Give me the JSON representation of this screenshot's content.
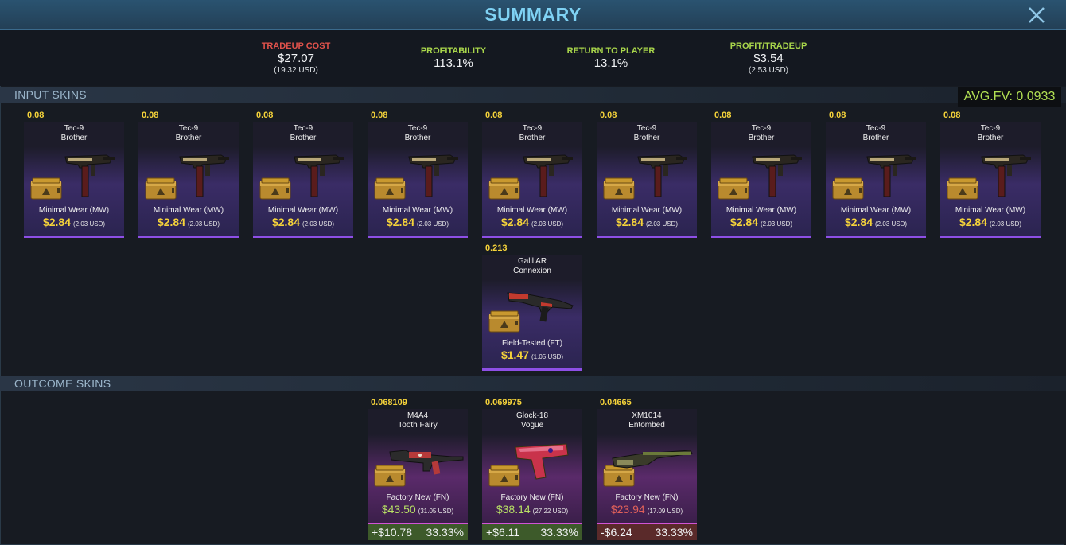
{
  "header": {
    "title": "SUMMARY"
  },
  "stats": {
    "cost": {
      "label": "TRADEUP COST",
      "value": "$27.07",
      "sub": "(19.32 USD)"
    },
    "profitability": {
      "label": "PROFITABILITY",
      "value": "113.1%"
    },
    "rtp": {
      "label": "RETURN TO PLAYER",
      "value": "13.1%"
    },
    "profit": {
      "label": "PROFIT/TRADEUP",
      "value": "$3.54",
      "sub": "(2.53 USD)"
    }
  },
  "input_section": {
    "title": "INPUT SKINS",
    "avg_fv": "AVG.FV: 0.0933"
  },
  "outcome_section": {
    "title": "OUTCOME SKINS"
  },
  "inputs": [
    {
      "fv": "0.08",
      "weapon": "Tec-9",
      "skin": "Brother",
      "wear": "Minimal Wear (MW)",
      "price": "$2.84",
      "usd": "(2.03 USD)"
    },
    {
      "fv": "0.08",
      "weapon": "Tec-9",
      "skin": "Brother",
      "wear": "Minimal Wear (MW)",
      "price": "$2.84",
      "usd": "(2.03 USD)"
    },
    {
      "fv": "0.08",
      "weapon": "Tec-9",
      "skin": "Brother",
      "wear": "Minimal Wear (MW)",
      "price": "$2.84",
      "usd": "(2.03 USD)"
    },
    {
      "fv": "0.08",
      "weapon": "Tec-9",
      "skin": "Brother",
      "wear": "Minimal Wear (MW)",
      "price": "$2.84",
      "usd": "(2.03 USD)"
    },
    {
      "fv": "0.08",
      "weapon": "Tec-9",
      "skin": "Brother",
      "wear": "Minimal Wear (MW)",
      "price": "$2.84",
      "usd": "(2.03 USD)"
    },
    {
      "fv": "0.08",
      "weapon": "Tec-9",
      "skin": "Brother",
      "wear": "Minimal Wear (MW)",
      "price": "$2.84",
      "usd": "(2.03 USD)"
    },
    {
      "fv": "0.08",
      "weapon": "Tec-9",
      "skin": "Brother",
      "wear": "Minimal Wear (MW)",
      "price": "$2.84",
      "usd": "(2.03 USD)"
    },
    {
      "fv": "0.08",
      "weapon": "Tec-9",
      "skin": "Brother",
      "wear": "Minimal Wear (MW)",
      "price": "$2.84",
      "usd": "(2.03 USD)"
    },
    {
      "fv": "0.08",
      "weapon": "Tec-9",
      "skin": "Brother",
      "wear": "Minimal Wear (MW)",
      "price": "$2.84",
      "usd": "(2.03 USD)"
    },
    {
      "fv": "0.213",
      "weapon": "Galil AR",
      "skin": "Connexion",
      "wear": "Field-Tested (FT)",
      "price": "$1.47",
      "usd": "(1.05 USD)"
    }
  ],
  "outcomes": [
    {
      "fv": "0.068109",
      "weapon": "M4A4",
      "skin": "Tooth Fairy",
      "wear": "Factory New (FN)",
      "price": "$43.50",
      "usd": "(31.05 USD)",
      "pl": "+$10.78",
      "pct": "33.33%"
    },
    {
      "fv": "0.069975",
      "weapon": "Glock-18",
      "skin": "Vogue",
      "wear": "Factory New (FN)",
      "price": "$38.14",
      "usd": "(27.22 USD)",
      "pl": "+$6.11",
      "pct": "33.33%"
    },
    {
      "fv": "0.04665",
      "weapon": "XM1014",
      "skin": "Entombed",
      "wear": "Factory New (FN)",
      "price": "$23.94",
      "usd": "(17.09 USD)",
      "pl": "-$6.24",
      "pct": "33.33%"
    }
  ],
  "colors": {
    "accent": "#7fd2f4",
    "rarity_input": "#8e4fe6",
    "rarity_outcome": "#d154d6",
    "fv": "#f5d33a"
  }
}
